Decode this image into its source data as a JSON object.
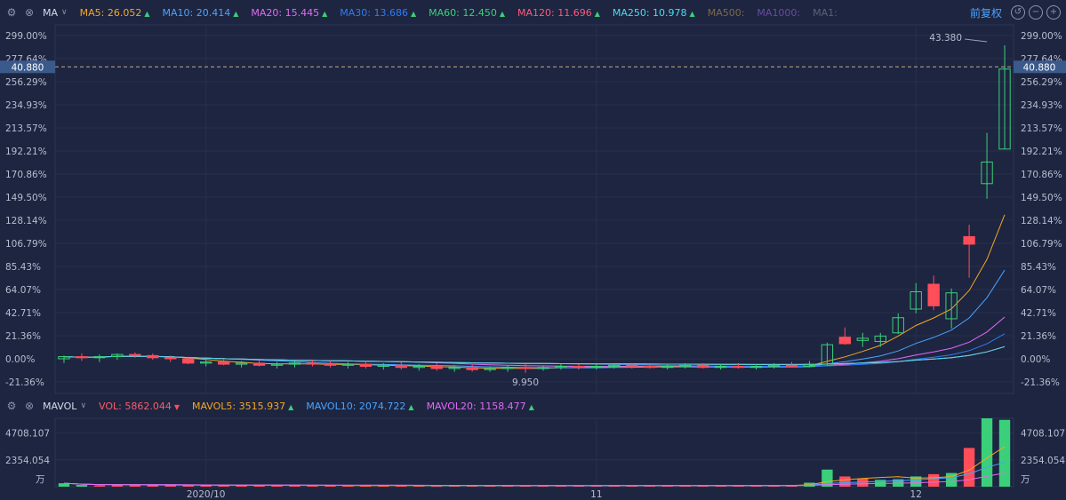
{
  "main_toolbar": {
    "indicator": "MA",
    "items": [
      {
        "label": "MA5: 26.052",
        "color": "#f5a623",
        "arrow": "▲"
      },
      {
        "label": "MA10: 20.414",
        "color": "#4aa3ff",
        "arrow": "▲"
      },
      {
        "label": "MA20: 15.445",
        "color": "#e36af5",
        "arrow": "▲"
      },
      {
        "label": "MA30: 13.686",
        "color": "#2f7cf6",
        "arrow": "▲"
      },
      {
        "label": "MA60: 12.450",
        "color": "#3ad07a",
        "arrow": "▲"
      },
      {
        "label": "MA120: 11.696",
        "color": "#ff5a7a",
        "arrow": "▲"
      },
      {
        "label": "MA250: 10.978",
        "color": "#4fd9f0",
        "arrow": "▲"
      },
      {
        "label": "MA500:",
        "color": "#7a6a4a",
        "arrow": ""
      },
      {
        "label": "MA1000:",
        "color": "#6a4aa0",
        "arrow": ""
      },
      {
        "label": "MA1:",
        "color": "#5a6278",
        "arrow": ""
      }
    ],
    "fuquan": "前复权"
  },
  "vol_toolbar": {
    "indicator": "MAVOL",
    "items": [
      {
        "label": "VOL: 5862.044",
        "color": "#ff5a6a",
        "arrow": "▼"
      },
      {
        "label": "MAVOL5: 3515.937",
        "color": "#f5a623",
        "arrow": "▲"
      },
      {
        "label": "MAVOL10: 2074.722",
        "color": "#4aa3ff",
        "arrow": "▲"
      },
      {
        "label": "MAVOL20: 1158.477",
        "color": "#e36af5",
        "arrow": "▲"
      }
    ]
  },
  "chart_data": [
    {
      "type": "candlestick",
      "y_unit": "%",
      "ylim": [
        -21.36,
        299.0
      ],
      "y_ticks": [
        "299.00%",
        "277.64%",
        "256.29%",
        "234.93%",
        "213.57%",
        "192.21%",
        "170.86%",
        "149.50%",
        "128.14%",
        "106.79%",
        "85.43%",
        "64.07%",
        "42.71%",
        "21.36%",
        "0.00%",
        "-21.36%"
      ],
      "x_ticks": [
        {
          "label": "2020/10",
          "index": 8
        },
        {
          "label": "11",
          "index": 30
        },
        {
          "label": "12",
          "index": 48
        }
      ],
      "current_price": {
        "label": "40.880",
        "pct": 270
      },
      "annotations": [
        {
          "label": "43.380",
          "index": 52,
          "pct": 290
        },
        {
          "label": "9.950",
          "index": 26,
          "pct": -13
        }
      ],
      "grid": true,
      "colors": {
        "up": "#3ad07a",
        "down": "#ff4d5a"
      },
      "candles": [
        {
          "o": 0,
          "h": 3,
          "l": -4,
          "c": 2
        },
        {
          "o": 2,
          "h": 5,
          "l": -2,
          "c": 1
        },
        {
          "o": 1,
          "h": 4,
          "l": -3,
          "c": 2
        },
        {
          "o": 2,
          "h": 5,
          "l": -1,
          "c": 4
        },
        {
          "o": 4,
          "h": 6,
          "l": 1,
          "c": 3
        },
        {
          "o": 3,
          "h": 5,
          "l": -1,
          "c": 1
        },
        {
          "o": 1,
          "h": 3,
          "l": -3,
          "c": 0
        },
        {
          "o": 0,
          "h": 2,
          "l": -5,
          "c": -4
        },
        {
          "o": -4,
          "h": -1,
          "l": -7,
          "c": -3
        },
        {
          "o": -3,
          "h": 0,
          "l": -6,
          "c": -5
        },
        {
          "o": -5,
          "h": -2,
          "l": -8,
          "c": -4
        },
        {
          "o": -4,
          "h": -1,
          "l": -7,
          "c": -6
        },
        {
          "o": -6,
          "h": -3,
          "l": -9,
          "c": -5
        },
        {
          "o": -5,
          "h": -2,
          "l": -8,
          "c": -4
        },
        {
          "o": -4,
          "h": -1,
          "l": -7,
          "c": -5
        },
        {
          "o": -5,
          "h": -2,
          "l": -8,
          "c": -6
        },
        {
          "o": -6,
          "h": -3,
          "l": -9,
          "c": -5
        },
        {
          "o": -5,
          "h": -2,
          "l": -9,
          "c": -7
        },
        {
          "o": -7,
          "h": -4,
          "l": -10,
          "c": -6
        },
        {
          "o": -6,
          "h": -3,
          "l": -10,
          "c": -8
        },
        {
          "o": -8,
          "h": -5,
          "l": -11,
          "c": -7
        },
        {
          "o": -7,
          "h": -4,
          "l": -11,
          "c": -9
        },
        {
          "o": -9,
          "h": -6,
          "l": -12,
          "c": -8
        },
        {
          "o": -8,
          "h": -5,
          "l": -12,
          "c": -10
        },
        {
          "o": -10,
          "h": -7,
          "l": -12,
          "c": -9
        },
        {
          "o": -9,
          "h": -6,
          "l": -12,
          "c": -8
        },
        {
          "o": -8,
          "h": -5,
          "l": -13,
          "c": -9
        },
        {
          "o": -9,
          "h": -6,
          "l": -11,
          "c": -8
        },
        {
          "o": -8,
          "h": -5,
          "l": -10,
          "c": -7
        },
        {
          "o": -7,
          "h": -5,
          "l": -10,
          "c": -8
        },
        {
          "o": -8,
          "h": -5,
          "l": -10,
          "c": -7
        },
        {
          "o": -7,
          "h": -4,
          "l": -9,
          "c": -6
        },
        {
          "o": -6,
          "h": -4,
          "l": -9,
          "c": -7
        },
        {
          "o": -7,
          "h": -4,
          "l": -9,
          "c": -8
        },
        {
          "o": -8,
          "h": -5,
          "l": -10,
          "c": -7
        },
        {
          "o": -7,
          "h": -4,
          "l": -9,
          "c": -6
        },
        {
          "o": -6,
          "h": -4,
          "l": -9,
          "c": -8
        },
        {
          "o": -8,
          "h": -5,
          "l": -10,
          "c": -7
        },
        {
          "o": -7,
          "h": -4,
          "l": -9,
          "c": -8
        },
        {
          "o": -8,
          "h": -5,
          "l": -10,
          "c": -7
        },
        {
          "o": -7,
          "h": -4,
          "l": -9,
          "c": -6
        },
        {
          "o": -6,
          "h": -3,
          "l": -8,
          "c": -7
        },
        {
          "o": -7,
          "h": -2,
          "l": -8,
          "c": -5
        },
        {
          "o": -5,
          "h": 15,
          "l": -6,
          "c": 13
        },
        {
          "o": 20,
          "h": 29,
          "l": 13,
          "c": 14
        },
        {
          "o": 17,
          "h": 24,
          "l": 11,
          "c": 19
        },
        {
          "o": 16,
          "h": 24,
          "l": 11,
          "c": 21
        },
        {
          "o": 24,
          "h": 42,
          "l": 23,
          "c": 38
        },
        {
          "o": 46,
          "h": 70,
          "l": 42,
          "c": 62
        },
        {
          "o": 69,
          "h": 77,
          "l": 45,
          "c": 49
        },
        {
          "o": 37,
          "h": 65,
          "l": 28,
          "c": 61
        },
        {
          "o": 113,
          "h": 124,
          "l": 75,
          "c": 106
        },
        {
          "o": 162,
          "h": 209,
          "l": 148,
          "c": 182
        },
        {
          "o": 194,
          "h": 290,
          "l": 194,
          "c": 268
        }
      ]
    },
    {
      "type": "bar",
      "y_ticks": [
        "4708.107",
        "2354.054"
      ],
      "y_unit_label": "万",
      "ylim": [
        0,
        6000
      ],
      "values": [
        300,
        150,
        120,
        160,
        140,
        180,
        130,
        110,
        120,
        100,
        150,
        140,
        130,
        120,
        100,
        110,
        100,
        90,
        110,
        130,
        80,
        70,
        80,
        100,
        90,
        80,
        90,
        110,
        90,
        80,
        100,
        120,
        90,
        80,
        100,
        90,
        110,
        90,
        100,
        80,
        120,
        150,
        350,
        1500,
        900,
        700,
        600,
        650,
        900,
        1100,
        1200,
        3400,
        6000,
        5862
      ],
      "up_down": [
        1,
        1,
        0,
        0,
        0,
        0,
        0,
        0,
        0,
        0,
        0,
        0,
        0,
        0,
        0,
        0,
        0,
        0,
        0,
        0,
        0,
        0,
        0,
        0,
        0,
        0,
        0,
        0,
        0,
        0,
        0,
        0,
        0,
        0,
        0,
        0,
        0,
        0,
        0,
        0,
        0,
        0,
        1,
        1,
        0,
        0,
        1,
        1,
        1,
        0,
        1,
        0,
        1,
        1
      ]
    }
  ]
}
